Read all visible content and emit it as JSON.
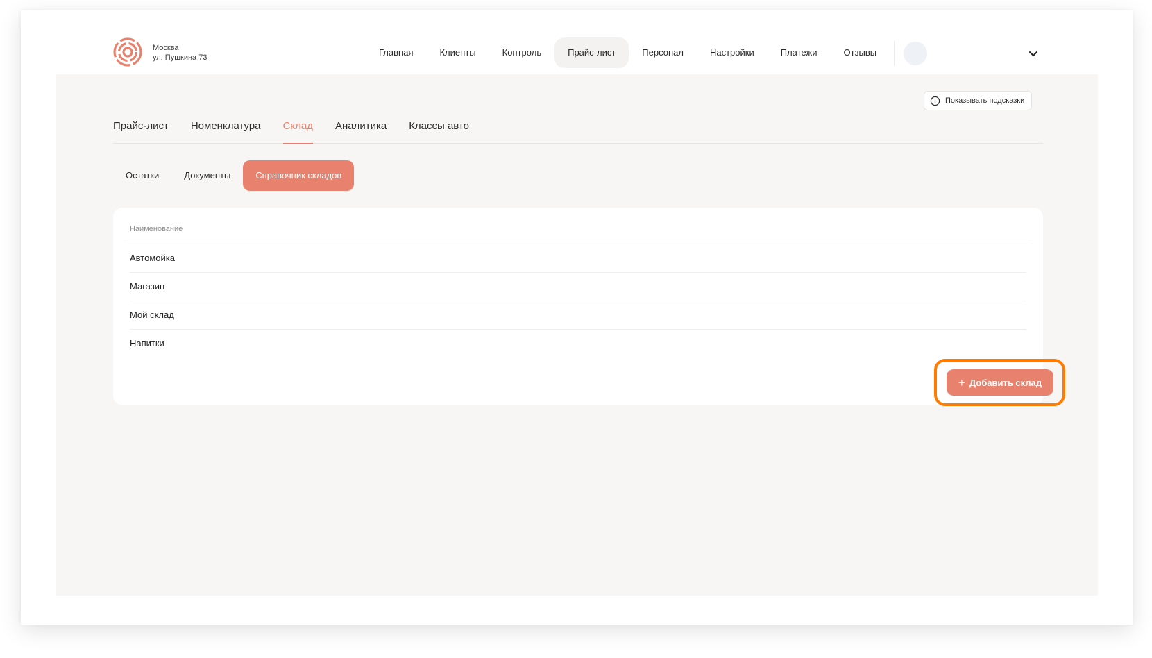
{
  "location": {
    "city": "Москва",
    "address": "ул. Пушкина 73"
  },
  "nav": {
    "items": [
      {
        "label": "Главная",
        "active": false
      },
      {
        "label": "Клиенты",
        "active": false
      },
      {
        "label": "Контроль",
        "active": false
      },
      {
        "label": "Прайс-лист",
        "active": true
      },
      {
        "label": "Персонал",
        "active": false
      },
      {
        "label": "Настройки",
        "active": false
      },
      {
        "label": "Платежи",
        "active": false
      },
      {
        "label": "Отзывы",
        "active": false
      }
    ]
  },
  "hints": {
    "label": "Показывать подсказки",
    "icon": "info-icon"
  },
  "tabs": [
    {
      "label": "Прайс-лист",
      "active": false
    },
    {
      "label": "Номенклатура",
      "active": false
    },
    {
      "label": "Склад",
      "active": true
    },
    {
      "label": "Аналитика",
      "active": false
    },
    {
      "label": "Классы авто",
      "active": false
    }
  ],
  "subtabs": [
    {
      "label": "Остатки",
      "active": false
    },
    {
      "label": "Документы",
      "active": false
    },
    {
      "label": "Справочник складов",
      "active": true
    }
  ],
  "table": {
    "column_header": "Наименование",
    "rows": [
      "Автомойка",
      "Магазин",
      "Мой склад",
      "Напитки"
    ]
  },
  "add_button": {
    "label": "Добавить склад",
    "icon": "plus-icon"
  },
  "colors": {
    "accent": "#e8826f",
    "highlight": "#ff7c00",
    "background": "#f7f6f4"
  }
}
